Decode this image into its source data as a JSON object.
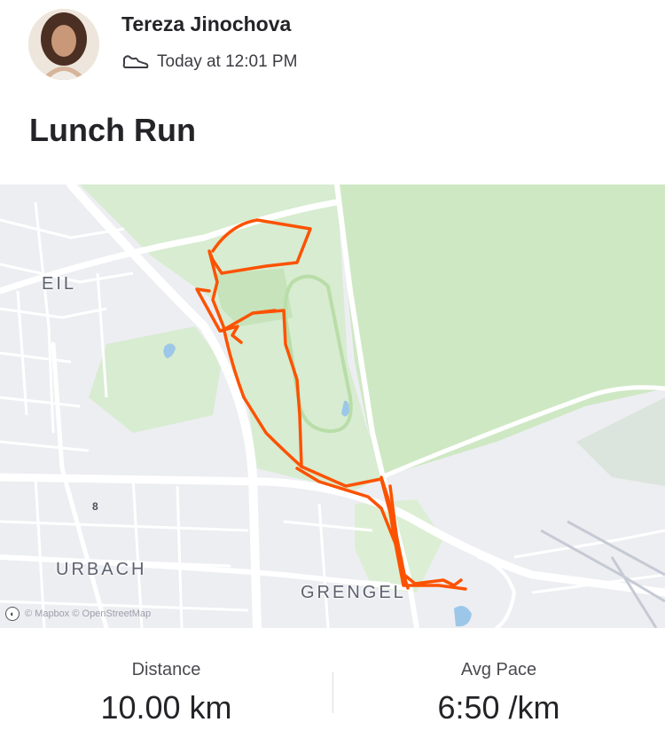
{
  "header": {
    "athlete_name": "Tereza Jinochova",
    "timestamp": "Today at 12:01 PM",
    "activity_icon": "shoe-icon"
  },
  "activity": {
    "title": "Lunch Run"
  },
  "map": {
    "labels": {
      "eil": "EIL",
      "urbach": "URBACH",
      "grengel": "GRENGEL",
      "road_8": "8"
    },
    "attribution": "© Mapbox © OpenStreetMap",
    "route_color": "#fc5200",
    "park_color": "#cfe8c4"
  },
  "stats": {
    "distance_label": "Distance",
    "distance_value": "10.00 km",
    "pace_label": "Avg Pace",
    "pace_value": "6:50 /km"
  }
}
